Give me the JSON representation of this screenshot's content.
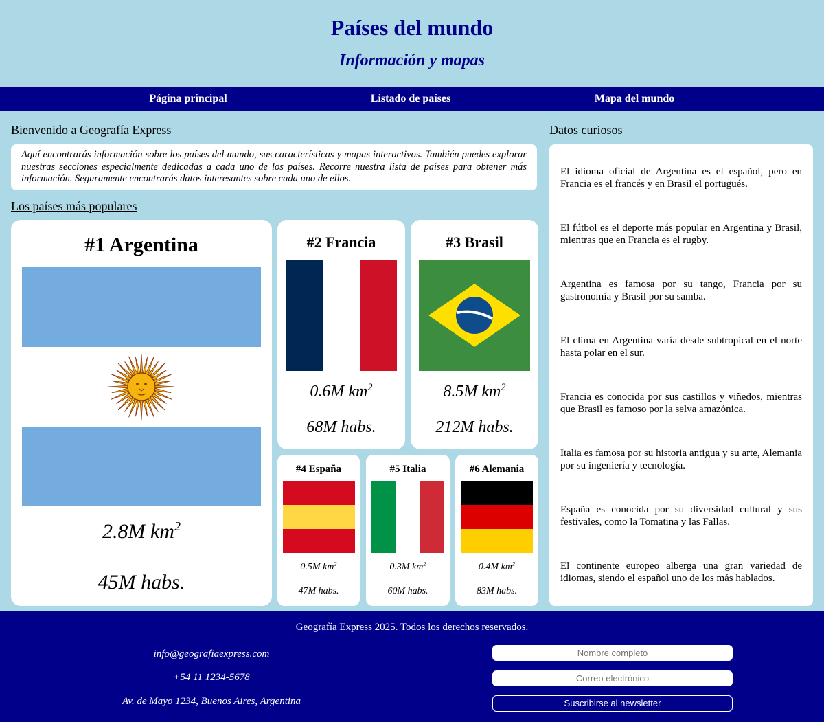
{
  "header": {
    "title": "Países del mundo",
    "subtitle": "Información y mapas"
  },
  "nav": {
    "items": [
      "Página principal",
      "Listado de países",
      "Mapa del mundo"
    ]
  },
  "welcome": {
    "title": "Bienvenido a Geografía Express",
    "text": "Aquí encontrarás información sobre los países del mundo, sus características y mapas interactivos. También puedes explorar nuestras secciones especialmente dedicadas a cada uno de los países. Recorre nuestra lista de países para obtener más información. Seguramente encontrarás datos interesantes sobre cada uno de ellos."
  },
  "popular": {
    "title": "Los países más populares",
    "countries": [
      {
        "rank": "#1 Argentina",
        "area": "2.8M km",
        "area_exp": "2",
        "population": "45M habs."
      },
      {
        "rank": "#2 Francia",
        "area": "0.6M km",
        "area_exp": "2",
        "population": "68M habs."
      },
      {
        "rank": "#3 Brasil",
        "area": "8.5M km",
        "area_exp": "2",
        "population": "212M habs."
      },
      {
        "rank": "#4 España",
        "area": "0.5M km",
        "area_exp": "2",
        "population": "47M habs."
      },
      {
        "rank": "#5 Italia",
        "area": "0.3M km",
        "area_exp": "2",
        "population": "60M habs."
      },
      {
        "rank": "#6 Alemania",
        "area": "0.4M km",
        "area_exp": "2",
        "population": "83M habs."
      }
    ]
  },
  "facts": {
    "title": "Datos curiosos",
    "items": [
      "El idioma oficial de Argentina es el español, pero en Francia es el francés y en Brasil el portugués.",
      "El fútbol es el deporte más popular en Argentina y Brasil, mientras que en Francia es el rugby.",
      "Argentina es famosa por su tango, Francia por su gastronomía y Brasil por su samba.",
      "El clima en Argentina varía desde subtropical en el norte hasta polar en el sur.",
      "Francia es conocida por sus castillos y viñedos, mientras que Brasil es famoso por la selva amazónica.",
      "Italia es famosa por su historia antigua y su arte, Alemania por su ingeniería y tecnología.",
      "España es conocida por su diversidad cultural y sus festivales, como la Tomatina y las Fallas.",
      "El continente europeo alberga una gran variedad de idiomas, siendo el español uno de los más hablados."
    ]
  },
  "footer": {
    "copyright": "Geografía Express 2025. Todos los derechos reservados.",
    "email": "info@geografiaexpress.com",
    "phone": "+54 11 1234-5678",
    "address": "Av. de Mayo 1234, Buenos Aires, Argentina",
    "name_placeholder": "Nombre completo",
    "email_placeholder": "Correo electrónico",
    "subscribe_label": "Suscribirse al newsletter"
  },
  "colors": {
    "background": "#add8e6",
    "accent": "#00008b",
    "card": "#ffffff"
  }
}
